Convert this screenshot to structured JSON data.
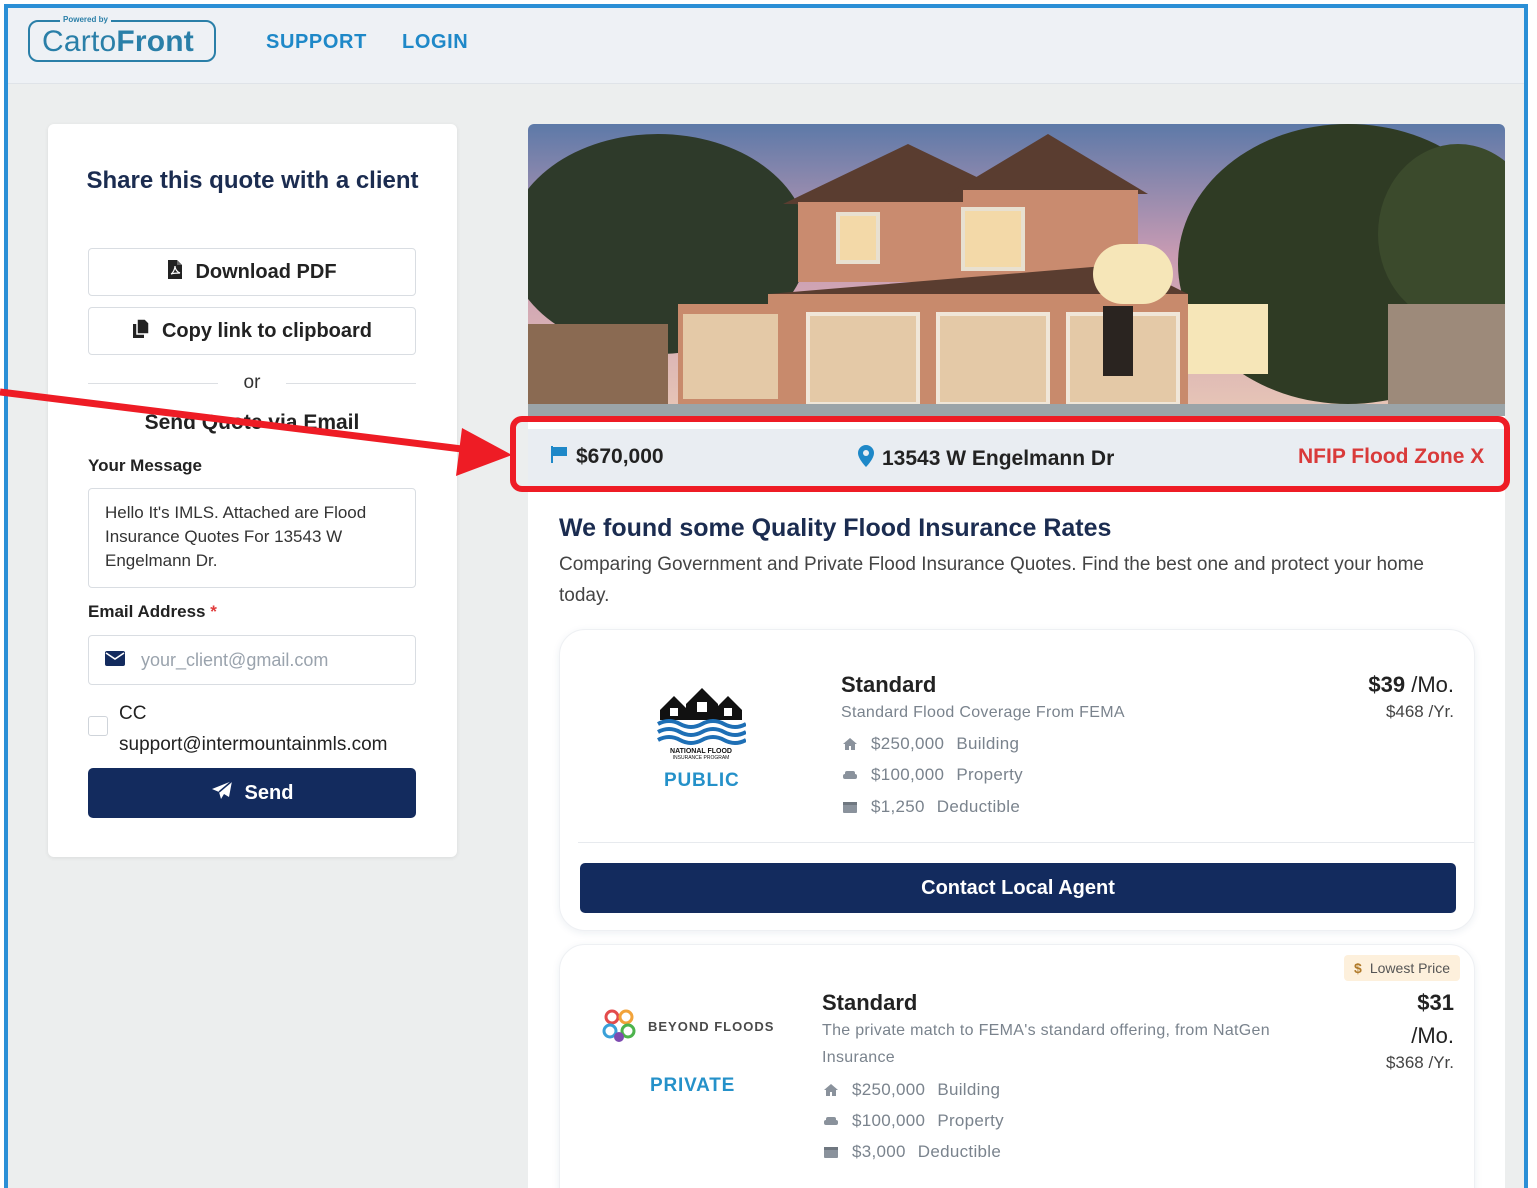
{
  "topbar": {
    "logo_powered": "Powered by",
    "logo_text_1": "Carto",
    "logo_text_2": "Front",
    "nav": [
      "SUPPORT",
      "LOGIN"
    ]
  },
  "share": {
    "title": "Share this quote with a client",
    "download_label": "Download PDF",
    "copy_label": "Copy link to clipboard",
    "or": "or",
    "send_title": "Send Quote via Email",
    "message_label": "Your Message",
    "message_value": "Hello It's IMLS. Attached are Flood Insurance Quotes For 13543 W Engelmann Dr.",
    "email_label": "Email Address",
    "email_required": "*",
    "email_placeholder": "your_client@gmail.com",
    "cc_label": "CC",
    "cc_email": "support@intermountainmls.com",
    "send_label": "Send"
  },
  "property": {
    "price": "$670,000",
    "address": "13543 W Engelmann Dr",
    "flood_zone": "NFIP Flood Zone X"
  },
  "results": {
    "title": "We found some Quality Flood Insurance Rates",
    "subtitle": "Comparing Government and Private Flood Insurance Quotes. Find the best one and protect your home today."
  },
  "quotes": [
    {
      "provider_logo_text": "NATIONAL FLOOD INSURANCE PROGRAM",
      "type": "PUBLIC",
      "plan": "Standard",
      "description": "Standard Flood Coverage From FEMA",
      "building": "$250,000",
      "building_label": "Building",
      "property": "$100,000",
      "property_label": "Property",
      "deductible": "$1,250",
      "deductible_label": "Deductible",
      "monthly": "$39",
      "monthly_unit": "/Mo.",
      "yearly": "$468 /Yr.",
      "cta": "Contact Local Agent"
    },
    {
      "provider_logo_text": "BEYOND FLOODS",
      "type": "PRIVATE",
      "badge": "Lowest Price",
      "plan": "Standard",
      "description": "The private match to FEMA's standard offering, from NatGen Insurance",
      "building": "$250,000",
      "building_label": "Building",
      "property": "$100,000",
      "property_label": "Property",
      "deductible": "$3,000",
      "deductible_label": "Deductible",
      "monthly": "$31",
      "monthly_unit": "/Mo.",
      "yearly": "$368 /Yr."
    }
  ],
  "colors": {
    "navy": "#132b5e",
    "accent_blue": "#2591c9",
    "zone_red": "#d93a3a",
    "highlight_red": "#ee1c25"
  }
}
